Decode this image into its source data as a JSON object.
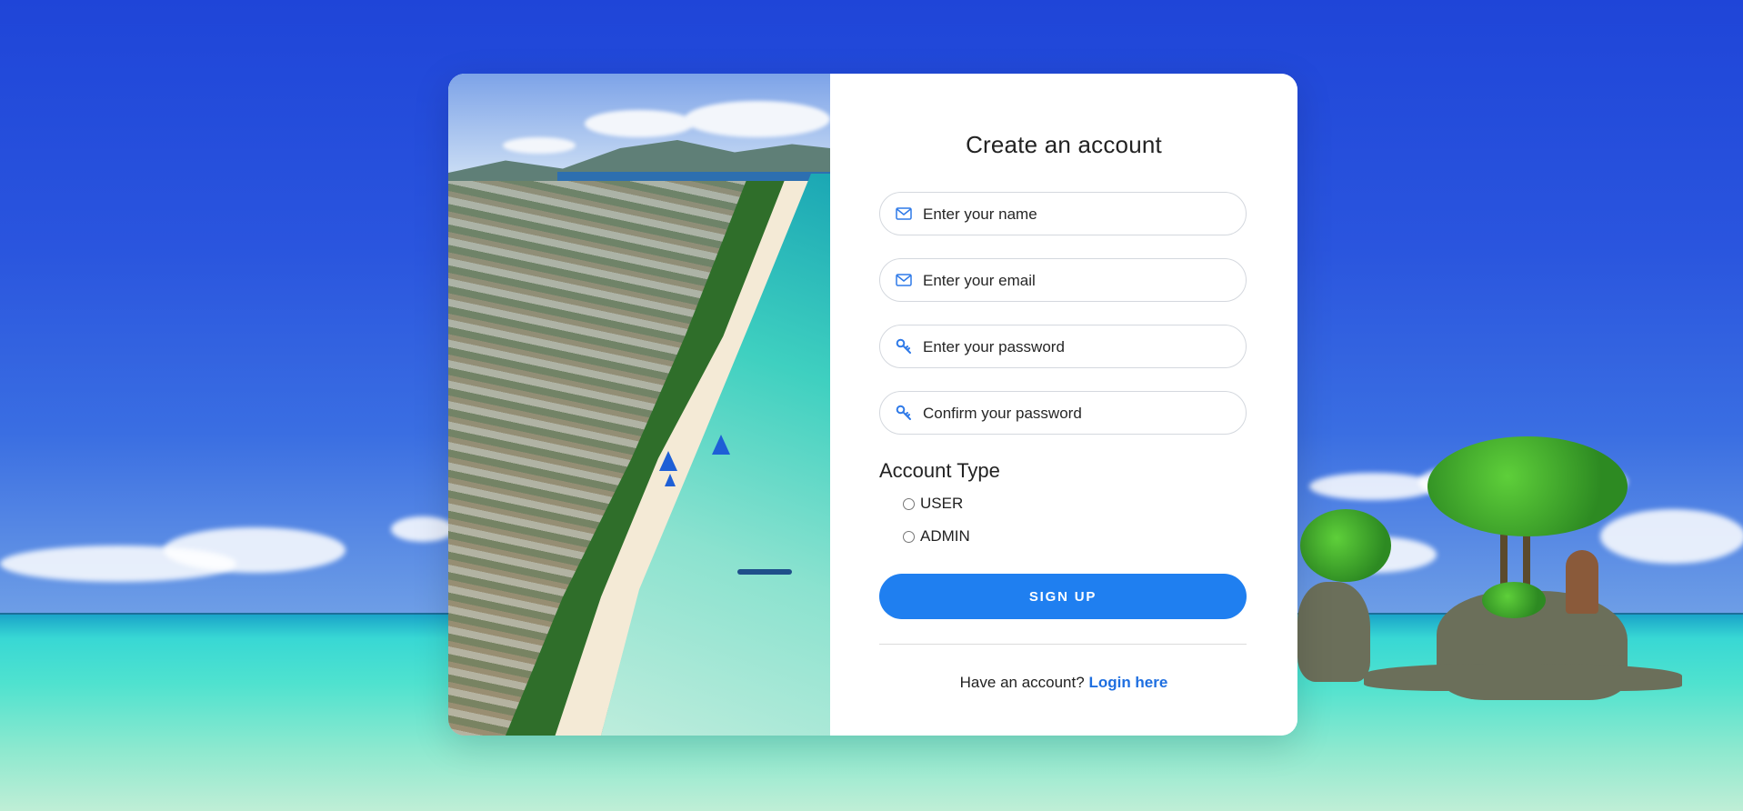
{
  "form": {
    "title": "Create an account",
    "fields": [
      {
        "placeholder": "Enter your name",
        "icon": "envelope-icon"
      },
      {
        "placeholder": "Enter your email",
        "icon": "envelope-icon"
      },
      {
        "placeholder": "Enter your password",
        "icon": "key-icon"
      },
      {
        "placeholder": "Confirm your password",
        "icon": "key-icon"
      }
    ],
    "account_type": {
      "label": "Account Type",
      "options": [
        "USER",
        "ADMIN"
      ]
    },
    "submit_label": "SIGN UP",
    "footer_text": "Have an account?",
    "login_link": "Login here"
  },
  "colors": {
    "accent": "#1f7ff0",
    "link": "#1f6fe0",
    "icon": "#2f7ae8"
  }
}
